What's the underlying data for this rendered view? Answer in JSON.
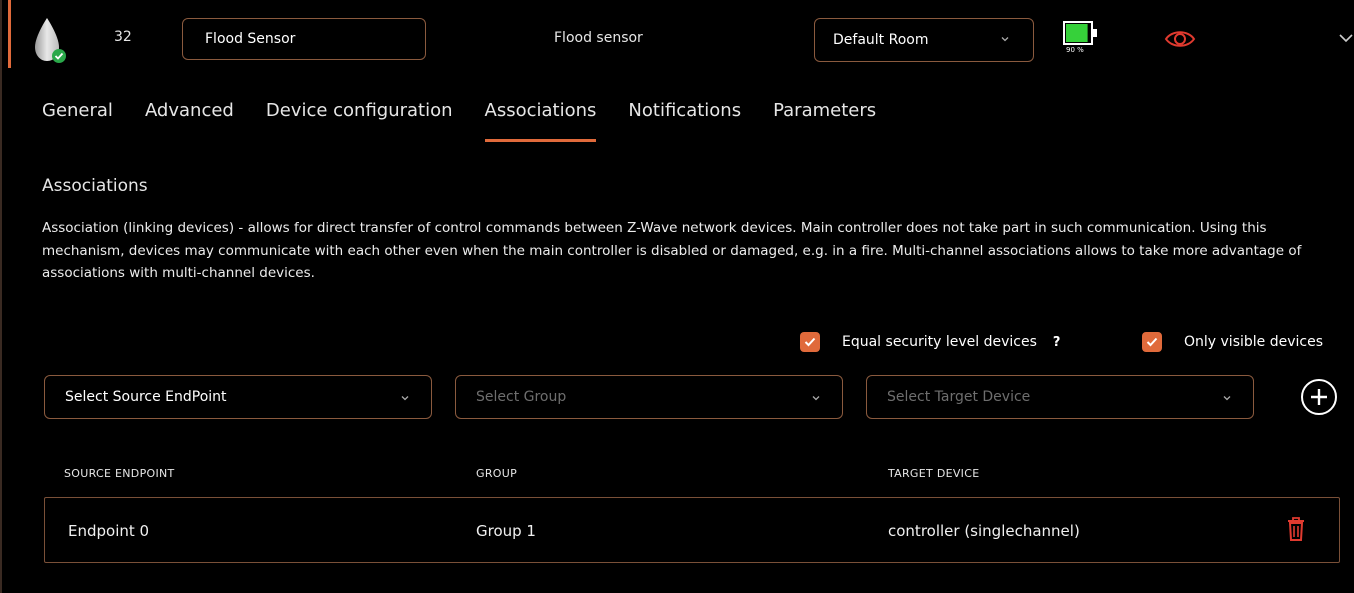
{
  "colors": {
    "accent": "#e06a3b",
    "border": "#8a5a3e",
    "background": "#000000",
    "battery": "#36d13a"
  },
  "header": {
    "device_icon": "water-drop-icon",
    "device_id": "32",
    "device_name": "Flood Sensor",
    "device_type": "Flood sensor",
    "room": "Default Room",
    "battery_percent": 90,
    "battery_label": "90 %",
    "visibility_icon": "eye-icon"
  },
  "tabs": [
    {
      "label": "General",
      "active": false
    },
    {
      "label": "Advanced",
      "active": false
    },
    {
      "label": "Device configuration",
      "active": false
    },
    {
      "label": "Associations",
      "active": true
    },
    {
      "label": "Notifications",
      "active": false
    },
    {
      "label": "Parameters",
      "active": false
    }
  ],
  "section": {
    "title": "Associations",
    "description": "Association (linking devices) - allows for direct transfer of control commands between Z-Wave network devices. Main controller does not take part in such communication. Using this mechanism, devices may communicate with each other even when the main controller is disabled or damaged, e.g. in a fire. Multi-channel associations allows to take more advantage of associations with multi-channel devices."
  },
  "filters": {
    "equal_security": {
      "label": "Equal security level devices",
      "checked": true,
      "help": "?"
    },
    "only_visible": {
      "label": "Only visible devices",
      "checked": true
    }
  },
  "selects": {
    "source_endpoint": "Select Source EndPoint",
    "group": "Select Group",
    "target_device": "Select Target Device"
  },
  "table": {
    "headers": [
      "SOURCE ENDPOINT",
      "GROUP",
      "TARGET DEVICE"
    ],
    "rows": [
      {
        "source": "Endpoint 0",
        "group": "Group 1",
        "target": "controller (singlechannel)"
      }
    ]
  }
}
